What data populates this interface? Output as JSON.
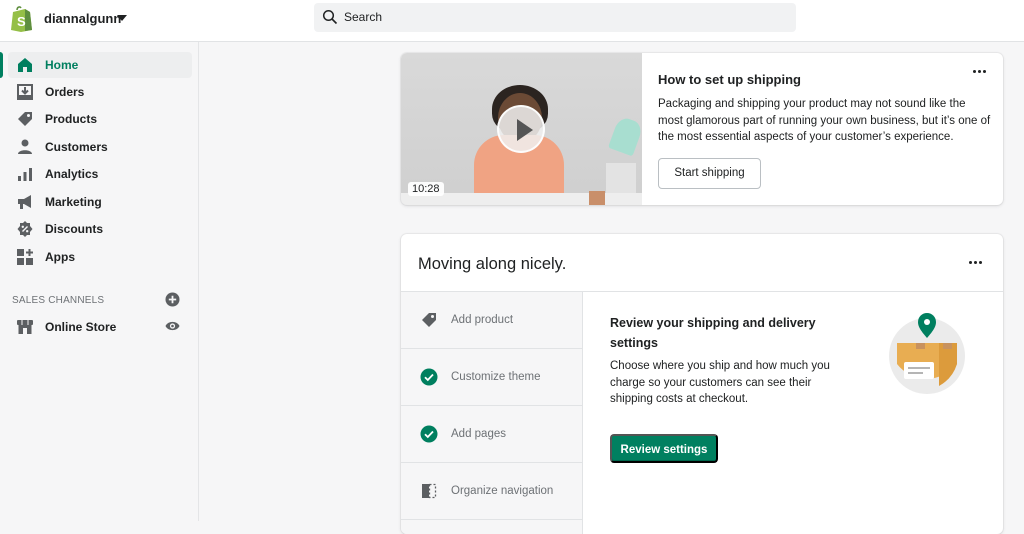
{
  "topbar": {
    "store_name": "diannalgunn",
    "search_placeholder": "Search"
  },
  "sidebar": {
    "items": [
      {
        "label": "Home",
        "icon": "home-icon",
        "active": true
      },
      {
        "label": "Orders",
        "icon": "orders-icon"
      },
      {
        "label": "Products",
        "icon": "tag-icon"
      },
      {
        "label": "Customers",
        "icon": "person-icon"
      },
      {
        "label": "Analytics",
        "icon": "bar-chart-icon"
      },
      {
        "label": "Marketing",
        "icon": "megaphone-icon"
      },
      {
        "label": "Discounts",
        "icon": "discount-icon"
      },
      {
        "label": "Apps",
        "icon": "apps-icon"
      }
    ],
    "sales_channels": {
      "title": "SALES CHANNELS",
      "items": [
        {
          "label": "Online Store",
          "icon": "store-icon"
        }
      ]
    }
  },
  "video_card": {
    "duration": "10:28",
    "title": "How to set up shipping",
    "description": "Packaging and shipping your product may not sound like the most glamorous part of running your own business, but it’s one of the most essential aspects of your customer’s experience.",
    "button": "Start shipping"
  },
  "setup_card": {
    "title": "Moving along nicely.",
    "steps": [
      {
        "label": "Add product",
        "status": "pending",
        "icon": "tag-icon"
      },
      {
        "label": "Customize theme",
        "status": "complete",
        "icon": "check-circle-icon"
      },
      {
        "label": "Add pages",
        "status": "complete",
        "icon": "check-circle-icon"
      },
      {
        "label": "Organize navigation",
        "status": "pending",
        "icon": "navigation-icon"
      }
    ],
    "detail": {
      "title": "Review your shipping and delivery settings",
      "description": "Choose where you ship and how much you charge so your customers can see their shipping costs at checkout.",
      "button": "Review settings"
    }
  },
  "colors": {
    "brand_green": "#008060",
    "active_text": "#007f5f",
    "shopify_logo": "#95bf47"
  }
}
